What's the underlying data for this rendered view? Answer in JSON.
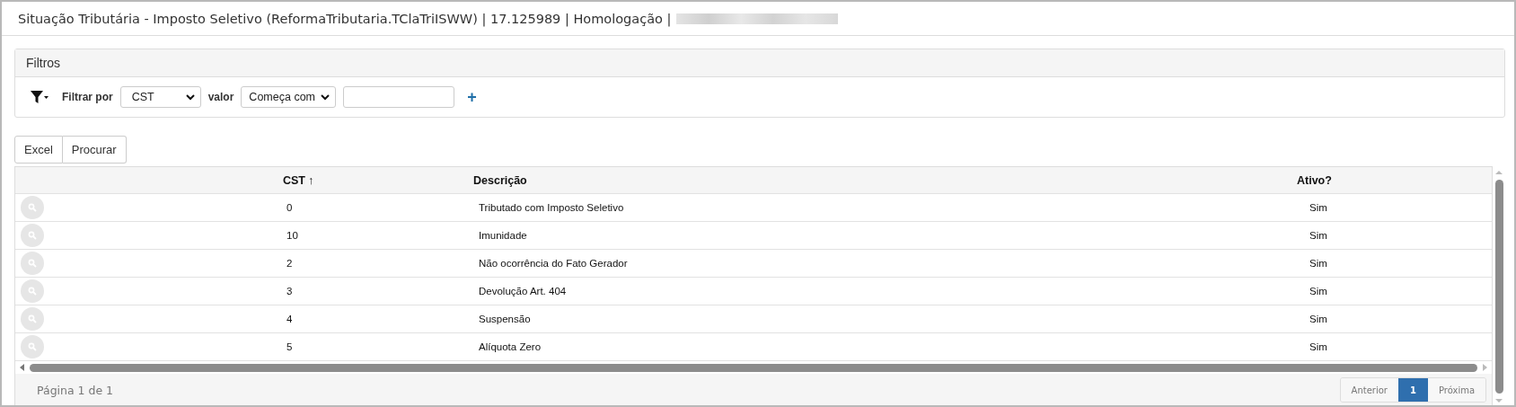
{
  "window": {
    "title": "Situação Tributária - Imposto Seletivo (ReformaTributaria.TClaTriISWW) | 17.125989 | Homologação |"
  },
  "filters": {
    "title": "Filtros",
    "filter_by_label": "Filtrar por",
    "field": "CST",
    "value_label": "valor",
    "operator": "Começa com",
    "add": "+"
  },
  "buttons": [
    "Excel",
    "Procurar"
  ],
  "table": {
    "columns": [
      {
        "label": "CST",
        "sort": "↑"
      },
      {
        "label": "Descrição"
      },
      {
        "label": "Ativo?"
      }
    ],
    "rows": [
      {
        "cst": "0",
        "descricao": "Tributado com Imposto Seletivo",
        "ativo": "Sim"
      },
      {
        "cst": "10",
        "descricao": "Imunidade",
        "ativo": "Sim"
      },
      {
        "cst": "2",
        "descricao": "Não ocorrência do Fato Gerador",
        "ativo": "Sim"
      },
      {
        "cst": "3",
        "descricao": "Devolução Art. 404",
        "ativo": "Sim"
      },
      {
        "cst": "4",
        "descricao": "Suspensão",
        "ativo": "Sim"
      },
      {
        "cst": "5",
        "descricao": "Alíquota Zero",
        "ativo": "Sim"
      }
    ]
  },
  "footer": {
    "page_info": "Página 1 de 1",
    "pagination": [
      {
        "label": "Anterior",
        "selected": false
      },
      {
        "label": "1",
        "selected": true
      },
      {
        "label": "Próxima",
        "selected": false
      }
    ]
  }
}
